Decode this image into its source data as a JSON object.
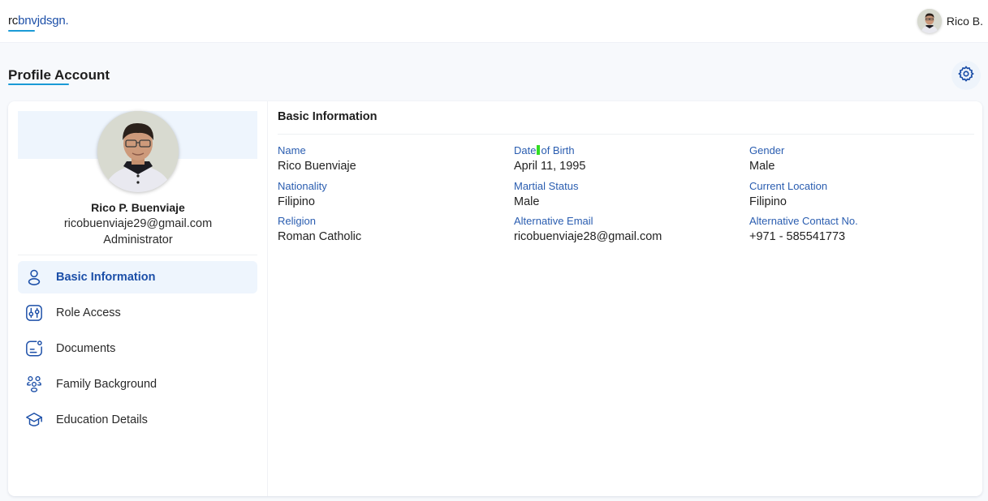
{
  "brand": {
    "logo_prefix": "rc",
    "logo_suffix": "bnvjdsgn.",
    "accent": "#1a9ad6",
    "primary": "#1c4fa8"
  },
  "user": {
    "display_name": "Rico B."
  },
  "page": {
    "title": "Profile Account"
  },
  "profile": {
    "full_name": "Rico P. Buenviaje",
    "email": "ricobuenviaje29@gmail.com",
    "role": "Administrator"
  },
  "nav": {
    "items": [
      {
        "label": "Basic Information",
        "icon": "user-icon",
        "active": true
      },
      {
        "label": "Role Access",
        "icon": "sliders-icon",
        "active": false
      },
      {
        "label": "Documents",
        "icon": "document-icon",
        "active": false
      },
      {
        "label": "Family Background",
        "icon": "family-icon",
        "active": false
      },
      {
        "label": "Education Details",
        "icon": "graduation-cap-icon",
        "active": false
      }
    ]
  },
  "basic_info": {
    "title": "Basic Information",
    "fields": [
      {
        "label": "Name",
        "value": "Rico Buenviaje"
      },
      {
        "label_a": "Date",
        "label_b": "of Birth",
        "value": "April 11, 1995"
      },
      {
        "label": "Gender",
        "value": "Male"
      },
      {
        "label": "Nationality",
        "value": "Filipino"
      },
      {
        "label": "Martial Status",
        "value": "Male"
      },
      {
        "label": "Current Location",
        "value": "Filipino"
      },
      {
        "label": "Religion",
        "value": "Roman Catholic"
      },
      {
        "label": "Alternative Email",
        "value": "ricobuenviaje28@gmail.com"
      },
      {
        "label": "Alternative Contact No.",
        "value": "+971 - 585541773"
      }
    ]
  }
}
